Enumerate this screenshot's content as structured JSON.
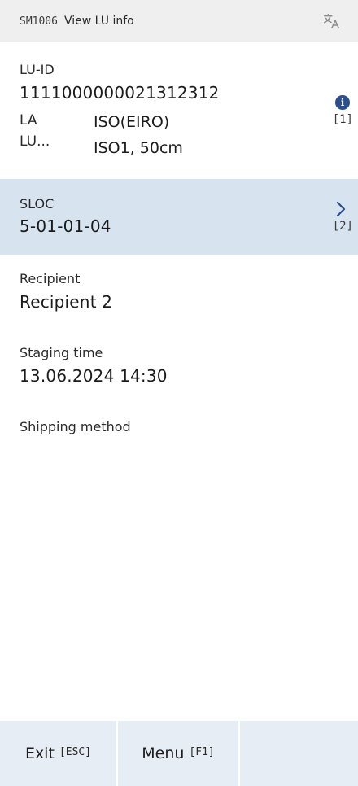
{
  "header": {
    "screen_code": "SM1006",
    "title": "View LU info",
    "translate_icon": "translate-icon"
  },
  "lu": {
    "id_label": "LU-ID",
    "id_value": "1111000000021312312",
    "la_label": "LA",
    "la_value": "ISO(EIRO)",
    "lu_label": "LU...",
    "lu_value": "ISO1, 50cm",
    "info_icon": "info-icon",
    "info_key": "[1]"
  },
  "sloc": {
    "label": "SLOC",
    "value": "5-01-01-04",
    "chevron_icon": "chevron-right-icon",
    "key": "[2]"
  },
  "recipient": {
    "label": "Recipient",
    "value": "Recipient 2"
  },
  "staging": {
    "label": "Staging time",
    "value": "13.06.2024 14:30"
  },
  "shipping": {
    "label": "Shipping method",
    "value": ""
  },
  "footer": {
    "exit_label": "Exit",
    "exit_key": "[ESC]",
    "menu_label": "Menu",
    "menu_key": "[F1]"
  },
  "colors": {
    "header_bg": "#efefef",
    "sloc_bg": "#d7e4f0",
    "footer_bg": "#e6edf5",
    "accent": "#2c4e8c"
  }
}
